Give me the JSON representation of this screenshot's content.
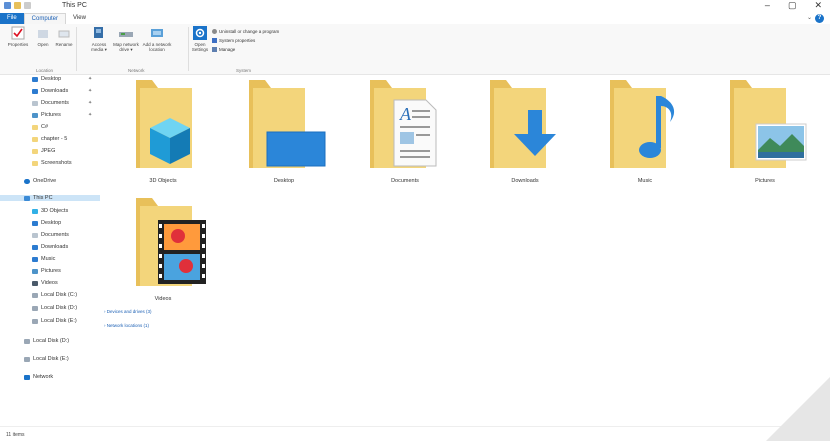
{
  "window": {
    "title": "This PC"
  },
  "tabs": [
    "File",
    "Computer",
    "View"
  ],
  "ribbon": {
    "buttons": [
      {
        "label": "Properties",
        "icon": "check-icon"
      },
      {
        "label": "Open",
        "icon": "folder-open-icon"
      },
      {
        "label": "Rename",
        "icon": "rename-icon"
      },
      {
        "label": "Access media ▾",
        "icon": "media-icon"
      },
      {
        "label": "Map network drive ▾",
        "icon": "network-drive-icon"
      },
      {
        "label": "Add a network location",
        "icon": "network-location-icon"
      },
      {
        "label": "Open Settings",
        "icon": "settings-icon"
      }
    ],
    "groups": [
      "Location",
      "Network",
      "System"
    ],
    "system_items": [
      "Uninstall or change a program",
      "System properties",
      "Manage"
    ]
  },
  "nav": {
    "quick": [
      {
        "label": "Desktop",
        "icon": "desktop-icon",
        "pinned": true
      },
      {
        "label": "Downloads",
        "icon": "download-icon",
        "pinned": true
      },
      {
        "label": "Documents",
        "icon": "documents-icon",
        "pinned": true
      },
      {
        "label": "Pictures",
        "icon": "pictures-icon",
        "pinned": true
      },
      {
        "label": "C#",
        "icon": "folder-icon",
        "pinned": false
      },
      {
        "label": "chapter - 5",
        "icon": "folder-icon",
        "pinned": false
      },
      {
        "label": "JPEG",
        "icon": "folder-icon",
        "pinned": false
      },
      {
        "label": "Screenshots",
        "icon": "folder-icon",
        "pinned": false
      }
    ],
    "onedrive": "OneDrive",
    "thispc": "This PC",
    "pc_items": [
      {
        "label": "3D Objects",
        "icon": "cube-icon"
      },
      {
        "label": "Desktop",
        "icon": "desktop-icon"
      },
      {
        "label": "Documents",
        "icon": "documents-icon"
      },
      {
        "label": "Downloads",
        "icon": "download-icon"
      },
      {
        "label": "Music",
        "icon": "music-icon"
      },
      {
        "label": "Pictures",
        "icon": "pictures-icon"
      },
      {
        "label": "Videos",
        "icon": "videos-icon"
      },
      {
        "label": "Local Disk (C:)",
        "icon": "drive-icon"
      },
      {
        "label": "Local Disk (D:)",
        "icon": "drive-icon"
      },
      {
        "label": "Local Disk (E:)",
        "icon": "drive-icon"
      }
    ],
    "extra_drives": [
      "Local Disk (D:)",
      "Local Disk (E:)"
    ],
    "network": "Network"
  },
  "content": {
    "folders": [
      {
        "label": "3D Objects",
        "overlay": "cube-icon"
      },
      {
        "label": "Desktop",
        "overlay": "desktop-icon"
      },
      {
        "label": "Documents",
        "overlay": "document-icon"
      },
      {
        "label": "Downloads",
        "overlay": "download-arrow-icon"
      },
      {
        "label": "Music",
        "overlay": "music-note-icon"
      },
      {
        "label": "Pictures",
        "overlay": "picture-icon"
      },
      {
        "label": "Videos",
        "overlay": "film-icon"
      }
    ],
    "groups": [
      "Devices and drives (3)",
      "Network locations (1)"
    ]
  },
  "status": {
    "count": "11 items"
  },
  "colors": {
    "folder": "#f3d57b",
    "folder_dark": "#e8c05a",
    "accent": "#1a73c9",
    "selected": "#cce4f7"
  }
}
